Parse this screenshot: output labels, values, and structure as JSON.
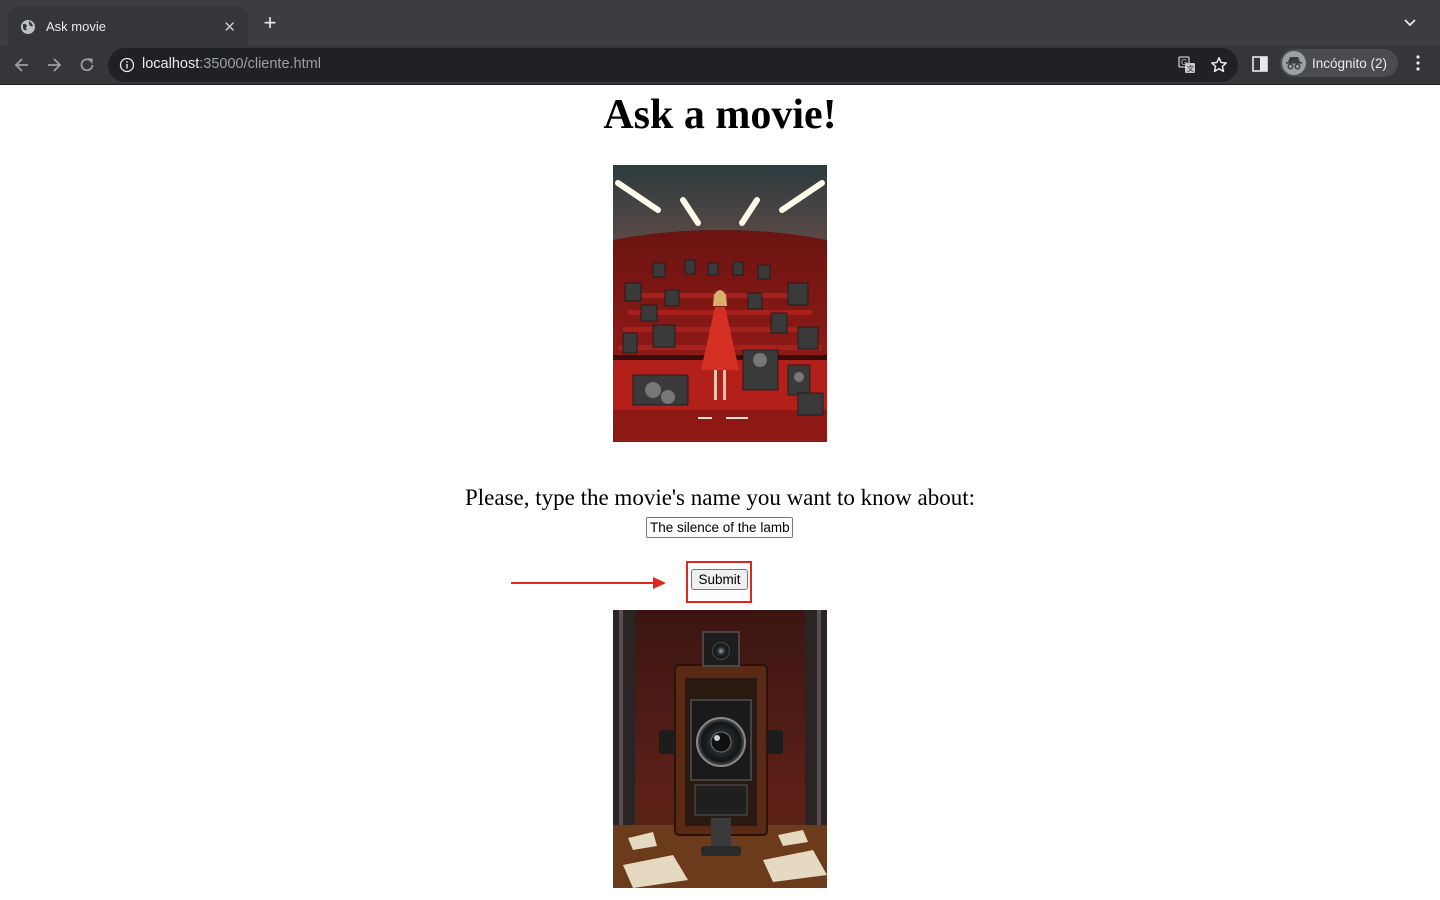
{
  "browser": {
    "tab_title": "Ask movie",
    "url_host": "localhost",
    "url_rest": ":35000/cliente.html",
    "profile_label": "Incógnito (2)",
    "icons": [
      "globe-icon",
      "close-icon",
      "plus-icon",
      "chevron-down-icon",
      "back-icon",
      "forward-icon",
      "reload-icon",
      "info-icon",
      "translate-icon",
      "star-icon",
      "side-panel-icon",
      "incognito-icon",
      "more-icon"
    ]
  },
  "page": {
    "heading": "Ask a movie!",
    "prompt": "Please, type the movie's name you want to know about:",
    "movie_input_value": "The silence of the lambs",
    "submit_label": "Submit",
    "images": [
      {
        "name": "cinema-hall-image",
        "description_for_alt": "Theater with vintage cameras and a woman in a red dress"
      },
      {
        "name": "vintage-camera-image",
        "description_for_alt": "Vintage film camera on a wooden table"
      }
    ],
    "annotation": {
      "color": "#e0281d"
    }
  }
}
